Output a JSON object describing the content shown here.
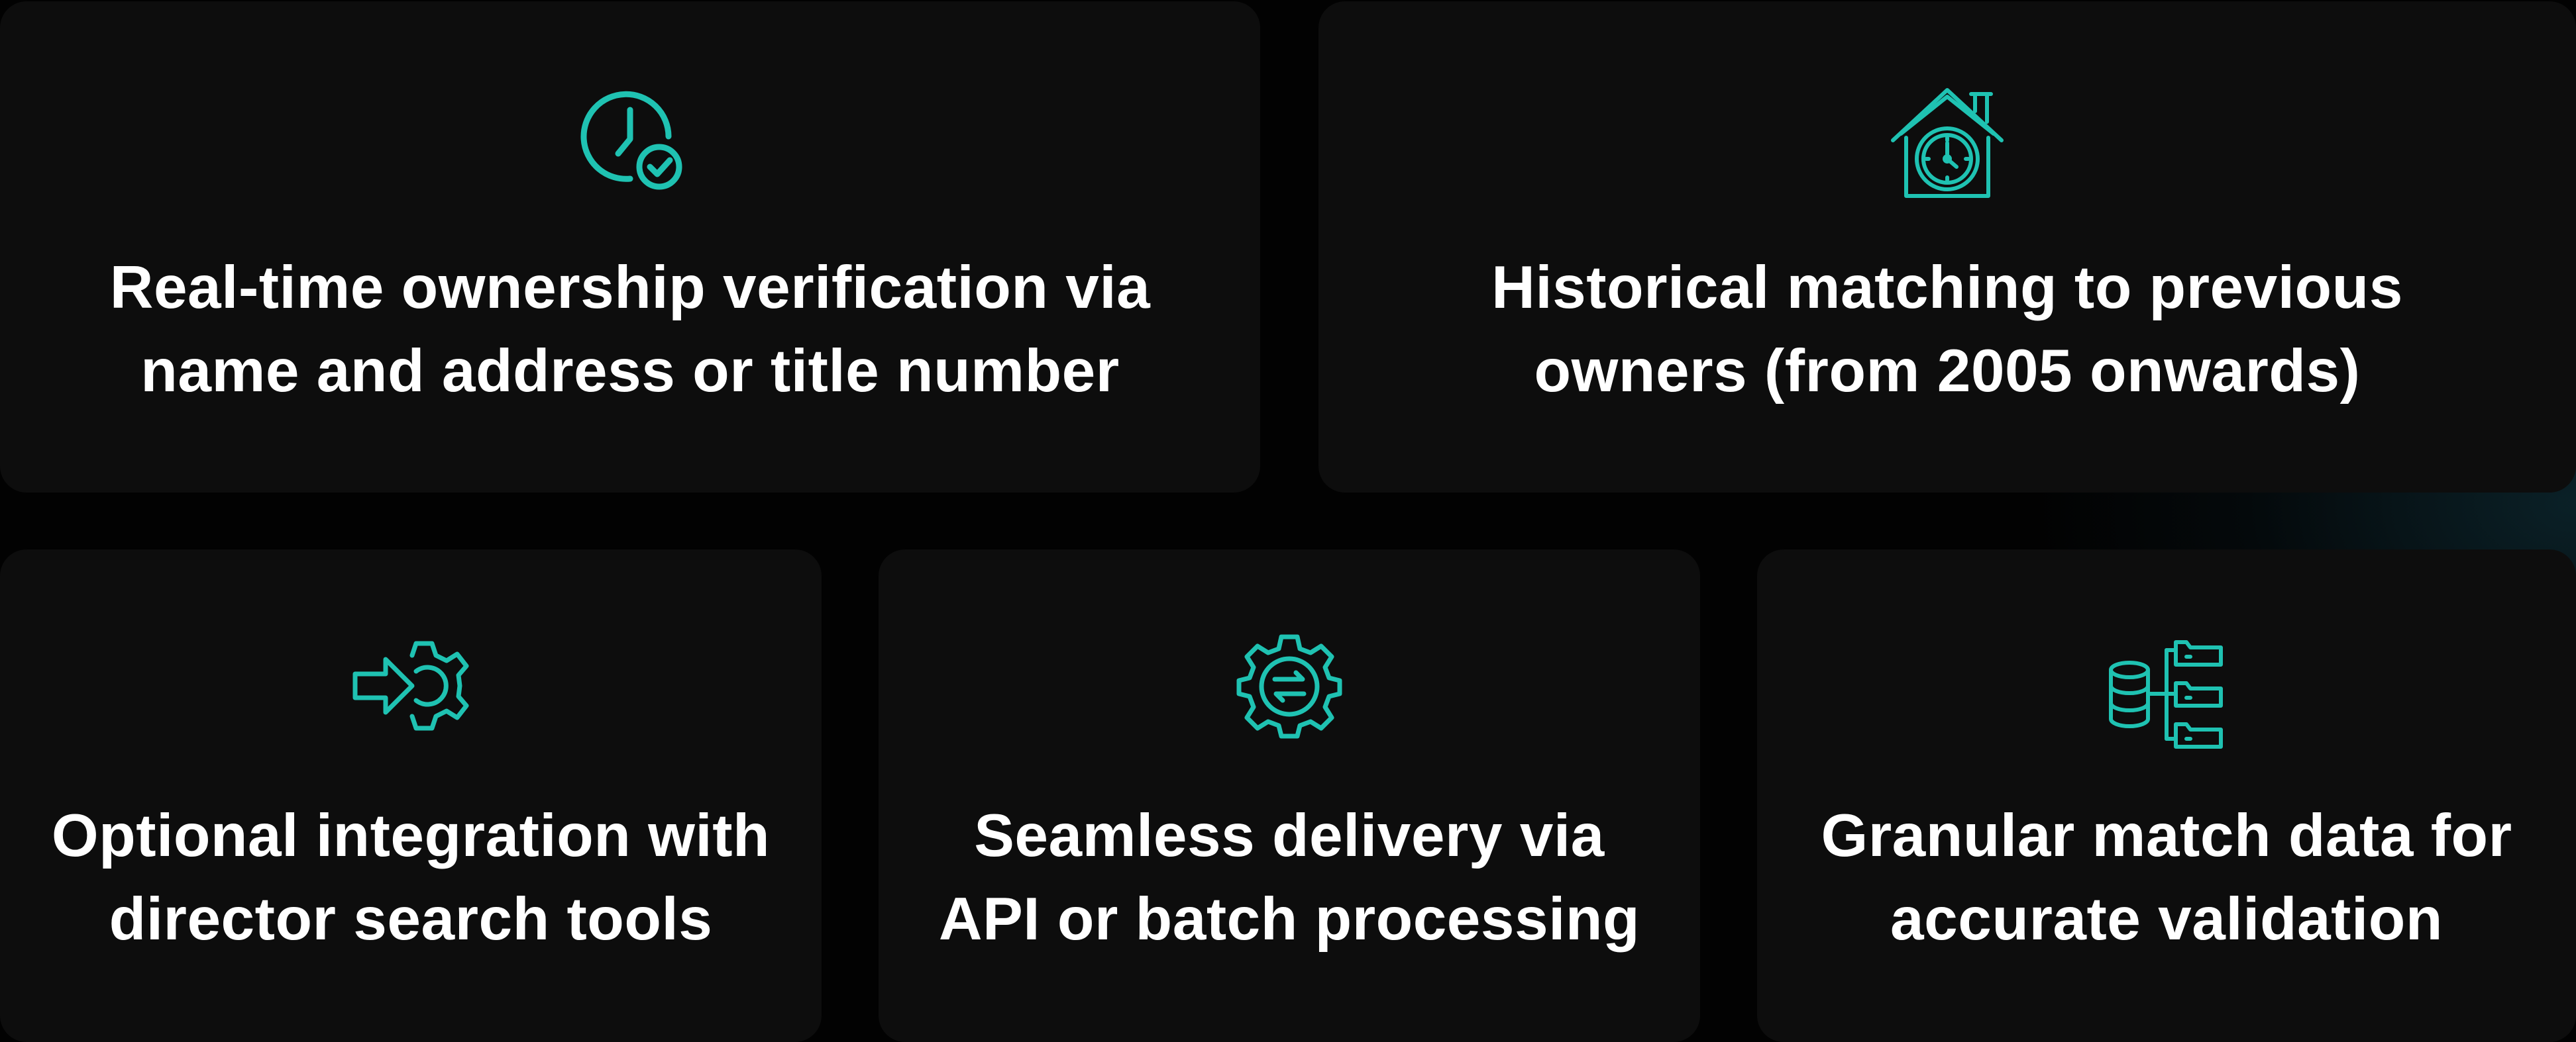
{
  "accent_color": "#1fc2b2",
  "cards": [
    {
      "icon": "clock-check-icon",
      "line1": "Real-time ownership verification via",
      "line2": "name and address or title number"
    },
    {
      "icon": "house-clock-icon",
      "line1": "Historical matching to previous",
      "line2": "owners (from 2005 onwards)"
    },
    {
      "icon": "arrow-gear-integration-icon",
      "line1": "Optional integration with",
      "line2": "director search tools"
    },
    {
      "icon": "gear-sync-arrows-icon",
      "line1": "Seamless delivery via",
      "line2": "API or batch processing"
    },
    {
      "icon": "database-folders-icon",
      "line1": "Granular match data for",
      "line2": "accurate validation"
    }
  ]
}
